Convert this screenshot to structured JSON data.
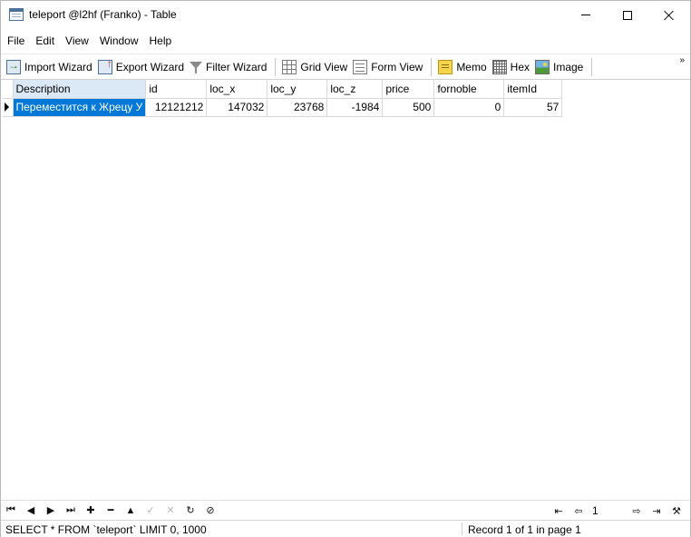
{
  "window": {
    "title": "teleport @l2hf (Franko) - Table"
  },
  "menu": {
    "items": [
      "File",
      "Edit",
      "View",
      "Window",
      "Help"
    ]
  },
  "toolbar": {
    "import_wizard": "Import Wizard",
    "export_wizard": "Export Wizard",
    "filter_wizard": "Filter Wizard",
    "grid_view": "Grid View",
    "form_view": "Form View",
    "memo": "Memo",
    "hex": "Hex",
    "image": "Image",
    "overflow_glyph": "»"
  },
  "grid": {
    "columns": [
      "Description",
      "id",
      "loc_x",
      "loc_y",
      "loc_z",
      "price",
      "fornoble",
      "itemId"
    ],
    "rows": [
      [
        "Переместится к Жрецу У",
        "12121212",
        "147032",
        "23768",
        "-1984",
        "500",
        "0",
        "57"
      ]
    ],
    "selected_column": "Description"
  },
  "navigation": {
    "first": "⏮",
    "prev": "◀",
    "next": "▶",
    "last": "⏭",
    "add": "✚",
    "delete": "━",
    "up": "▲",
    "apply": "✓",
    "cancel": "✕",
    "refresh": "↻",
    "stop": "⊘",
    "page_first": "⇤",
    "page_prev": "⇦",
    "page_number": "1",
    "page_next": "⇨",
    "page_last": "⇥",
    "settings": "⚒"
  },
  "status": {
    "sql": "SELECT * FROM `teleport` LIMIT 0, 1000",
    "record": "Record 1 of 1 in page 1"
  },
  "colors": {
    "selection": "#0078d7",
    "selected_header": "#dbe8f6"
  }
}
